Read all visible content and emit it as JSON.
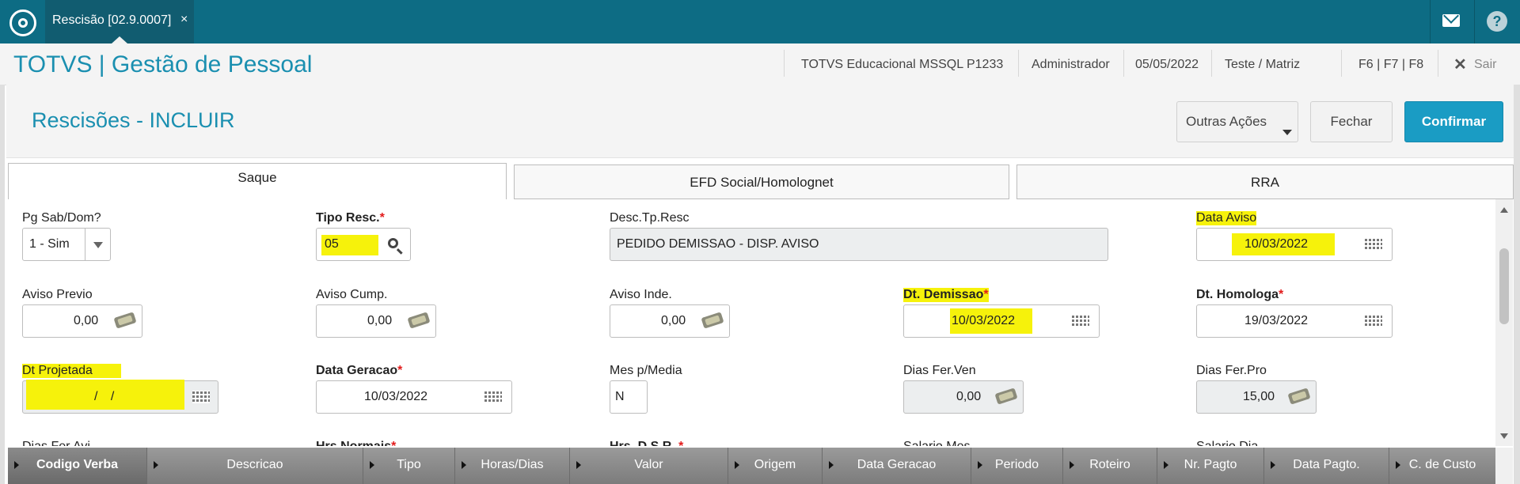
{
  "topbar": {
    "tab_label": "Rescisão [02.9.0007]",
    "tab_close": "×",
    "help_label": "?"
  },
  "appbar": {
    "title": "TOTVS | Gestão de Pessoal",
    "company": "TOTVS Educacional MSSQL P1233",
    "user": "Administrador",
    "date": "05/05/2022",
    "branch": "Teste / Matriz",
    "shortcuts": "F6 | F7 | F8",
    "exit_label": "Sair"
  },
  "page": {
    "title": "Rescisões - INCLUIR",
    "btn_other": "Outras Ações",
    "btn_close": "Fechar",
    "btn_confirm": "Confirmar"
  },
  "tabs": [
    {
      "label": "Saque",
      "active": true
    },
    {
      "label": "EFD Social/Homolognet",
      "active": false
    },
    {
      "label": "RRA",
      "active": false
    }
  ],
  "form": {
    "pg_sab_dom": {
      "label": "Pg Sab/Dom?",
      "value": "1 - Sim"
    },
    "tipo_resc": {
      "label": "Tipo Resc.",
      "value": "05"
    },
    "desc_tp_resc": {
      "label": "Desc.Tp.Resc",
      "value": "PEDIDO DEMISSAO - DISP. AVISO"
    },
    "data_aviso": {
      "label": "Data Aviso",
      "value": "10/03/2022"
    },
    "aviso_previo": {
      "label": "Aviso Previo",
      "value": "0,00"
    },
    "aviso_cump": {
      "label": "Aviso Cump.",
      "value": "0,00"
    },
    "aviso_inde": {
      "label": "Aviso Inde.",
      "value": "0,00"
    },
    "dt_demissao": {
      "label": "Dt. Demissao",
      "value": "10/03/2022"
    },
    "dt_homologa": {
      "label": "Dt. Homologa",
      "value": "19/03/2022"
    },
    "dt_projetada": {
      "label": "Dt Projetada",
      "value": "/  /"
    },
    "data_geracao": {
      "label": "Data Geracao",
      "value": "10/03/2022"
    },
    "mes_media": {
      "label": "Mes p/Media",
      "value": "N"
    },
    "dias_fer_ven": {
      "label": "Dias Fer.Ven",
      "value": "0,00"
    },
    "dias_fer_pro": {
      "label": "Dias Fer.Pro",
      "value": "15,00"
    },
    "partial_row": {
      "dias_fer_avi": "Dias Fer.Avi",
      "hrs_normais": "Hrs.Normais",
      "hrs_dsr": "Hrs. D.S.R.",
      "salario_mes": "Salario Mes",
      "salario_dia": "Salario Dia"
    },
    "required_mark": "*"
  },
  "grid": {
    "columns": [
      "Codigo Verba",
      "Descricao",
      "Tipo",
      "Horas/Dias",
      "Valor",
      "Origem",
      "Data Geracao",
      "Periodo",
      "Roteiro",
      "Nr. Pagto",
      "Data Pagto.",
      "C. de Custo"
    ]
  },
  "colors": {
    "topbar": "#0d6c84",
    "accent": "#1a8fb0",
    "primary_button": "#1a9cc4",
    "required": "#e21b1b",
    "highlight": "#f6f20b"
  },
  "icons": [
    "logo-icon",
    "mail-icon",
    "help-icon",
    "close-icon",
    "search-icon",
    "calendar-icon",
    "money-icon",
    "chevron-down-icon"
  ]
}
